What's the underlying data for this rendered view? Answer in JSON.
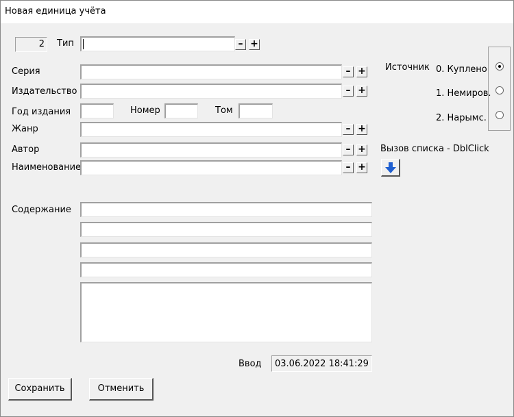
{
  "window": {
    "title": "Новая единица учёта"
  },
  "form": {
    "type_label": "Тип",
    "type_number": "2",
    "type_value": "",
    "series_label": "Серия",
    "series_value": "",
    "publisher_label": "Издательство",
    "publisher_value": "",
    "year_label": "Год издания",
    "year_value": "",
    "number_label": "Номер",
    "number_value": "",
    "volume_label": "Том",
    "volume_value": "",
    "genre_label": "Жанр",
    "genre_value": "",
    "author_label": "Автор",
    "author_value": "",
    "name_label": "Наименование",
    "name_value": "",
    "contents_label": "Содержание",
    "contents_lines": [
      "",
      "",
      "",
      ""
    ],
    "contents_text": "",
    "minus": "–",
    "plus": "+"
  },
  "source": {
    "label": "Источник",
    "options": [
      {
        "label": "0. Куплено",
        "selected": true
      },
      {
        "label": "1. Немиров.",
        "selected": false
      },
      {
        "label": "2. Нарымс.",
        "selected": false
      }
    ],
    "list_hint": "Вызов списка - DblClick",
    "list_button_icon": "arrow-down-icon"
  },
  "entry": {
    "label": "Ввод",
    "value": "03.06.2022 18:41:29"
  },
  "buttons": {
    "save": "Сохранить",
    "cancel": "Отменить"
  },
  "colors": {
    "arrow_blue": "#1f5fd0",
    "background": "#f0f0f0"
  }
}
